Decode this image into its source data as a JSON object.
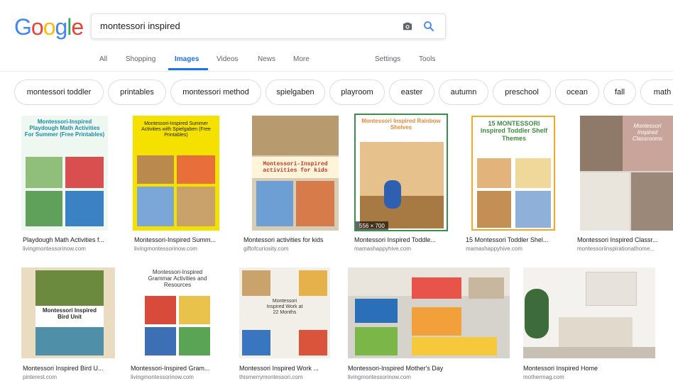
{
  "logo": {
    "text": "Google",
    "letters": [
      {
        "ch": "G",
        "color": "#4285f4"
      },
      {
        "ch": "o",
        "color": "#ea4335"
      },
      {
        "ch": "o",
        "color": "#fbbc05"
      },
      {
        "ch": "g",
        "color": "#4285f4"
      },
      {
        "ch": "l",
        "color": "#34a853"
      },
      {
        "ch": "e",
        "color": "#ea4335"
      }
    ]
  },
  "search": {
    "value": "montessori inspired",
    "camera_icon": "camera-icon",
    "search_icon": "magnifier-icon"
  },
  "tabs": {
    "all": "All",
    "shopping": "Shopping",
    "images": "Images",
    "videos": "Videos",
    "news": "News",
    "more": "More",
    "settings": "Settings",
    "tools": "Tools"
  },
  "chips": [
    "montessori toddler",
    "printables",
    "montessori method",
    "spielgaben",
    "playroom",
    "easter",
    "autumn",
    "preschool",
    "ocean",
    "fall",
    "math"
  ],
  "row1": [
    {
      "title": "Playdough Math Activities f...",
      "source": "livingmontessorinow.com",
      "overlay": "Montessori-Inspired Playdough Math Activities For Summer (Free Printables)"
    },
    {
      "title": "Montessori-Inspired Summ...",
      "source": "livingmontessorinow.com",
      "overlay": "Montessori-Inspired Summer Activities with Spielgaben (Free Printables)"
    },
    {
      "title": "Montessori activities for kids",
      "source": "giftofcuriosity.com",
      "overlay": "Montessori-Inspired activities for kids"
    },
    {
      "title": "Montessori Inspired Toddle...",
      "source": "mamashappyhive.com",
      "overlay": "Montessori Inspired Rainbow Shelves",
      "dims": "556 × 700"
    },
    {
      "title": "15 Montessori Toddler Shel...",
      "source": "mamashappyhive.com",
      "overlay": "15 MONTESSORI Inspired Toddler Shelf Themes"
    },
    {
      "title": "Montessori Inspired Classr...",
      "source": "montessoriinspirationathome...",
      "overlay": "Montessori Inspired Classrooms"
    }
  ],
  "row2": [
    {
      "title": "Montessori Inspired Bird U...",
      "source": "pinterest.com",
      "overlay": "Montessori Inspired Bird Unit"
    },
    {
      "title": "Montessori-Inspired Gram...",
      "source": "livingmontessorinow.com",
      "overlay": "Montessori-Inspired Grammar Activities and Resources"
    },
    {
      "title": "Montessori Inspired Work ...",
      "source": "thismerrymontessori.com",
      "overlay": "Montessori Inspired Work at 22 Months"
    },
    {
      "title": "Montessori-Inspired Mother's Day",
      "source": "livingmontessorinow.com"
    },
    {
      "title": "Montessori Inspired Home",
      "source": "mothermag.com"
    }
  ]
}
